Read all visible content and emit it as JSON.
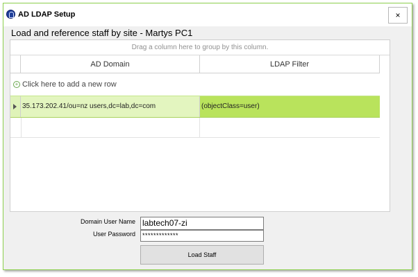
{
  "window": {
    "title": "AD LDAP Setup",
    "close_label": "×"
  },
  "header": {
    "title": "Load and reference staff by site - Martys PC1"
  },
  "grid": {
    "group_hint": "Drag a column here to group by this column.",
    "columns": [
      "AD Domain",
      "LDAP Filter"
    ],
    "new_row_label": "Click here to add a new row",
    "rows": [
      {
        "domain": "35.173.202.41/ou=nz users,dc=lab,dc=com",
        "filter": "(objectClass=user)"
      }
    ]
  },
  "form": {
    "username_label": "Domain User Name",
    "username_value": "labtech07-zi",
    "password_label": "User Password",
    "password_value": "*************",
    "load_button": "Load Staff"
  },
  "colors": {
    "selected_row": "#b9e35c",
    "accent_border": "#8fd14f"
  },
  "icons": [
    "app-icon",
    "close-icon",
    "add-row-icon",
    "row-indicator-arrow-icon"
  ]
}
